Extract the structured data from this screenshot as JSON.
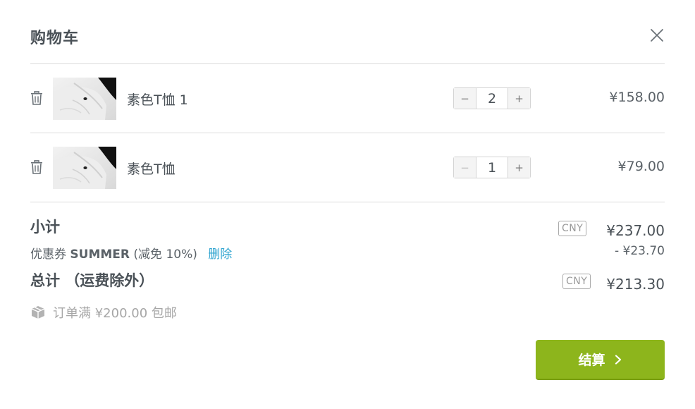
{
  "cart": {
    "title": "购物车"
  },
  "icons": {
    "close": "close-icon",
    "trash": "trash-icon",
    "shipping": "package-box-icon",
    "checkout_arrow": "chevron-right-icon"
  },
  "items": [
    {
      "name": "素色T恤 1",
      "quantity": "2",
      "price": "¥158.00",
      "minus": "−",
      "plus": "+",
      "minus_disabled": false
    },
    {
      "name": "素色T恤",
      "quantity": "1",
      "price": "¥79.00",
      "minus": "−",
      "plus": "+",
      "minus_disabled": true
    }
  ],
  "summary": {
    "subtotal_label": "小计",
    "subtotal_currency": "CNY",
    "subtotal_amount": "¥237.00",
    "coupon_prefix": "优惠券",
    "coupon_code": "SUMMER",
    "coupon_detail": "(减免 10%)",
    "coupon_remove": "删除",
    "discount_amount": "- ¥23.70",
    "total_label": "总计 （运费除外）",
    "total_currency": "CNY",
    "total_amount": "¥213.30",
    "shipping_note": "订单满 ¥200.00 包邮"
  },
  "checkout": {
    "label": "结算"
  },
  "colors": {
    "accent": "#8db51c",
    "link": "#2fa4d0",
    "text": "#4a5157"
  }
}
